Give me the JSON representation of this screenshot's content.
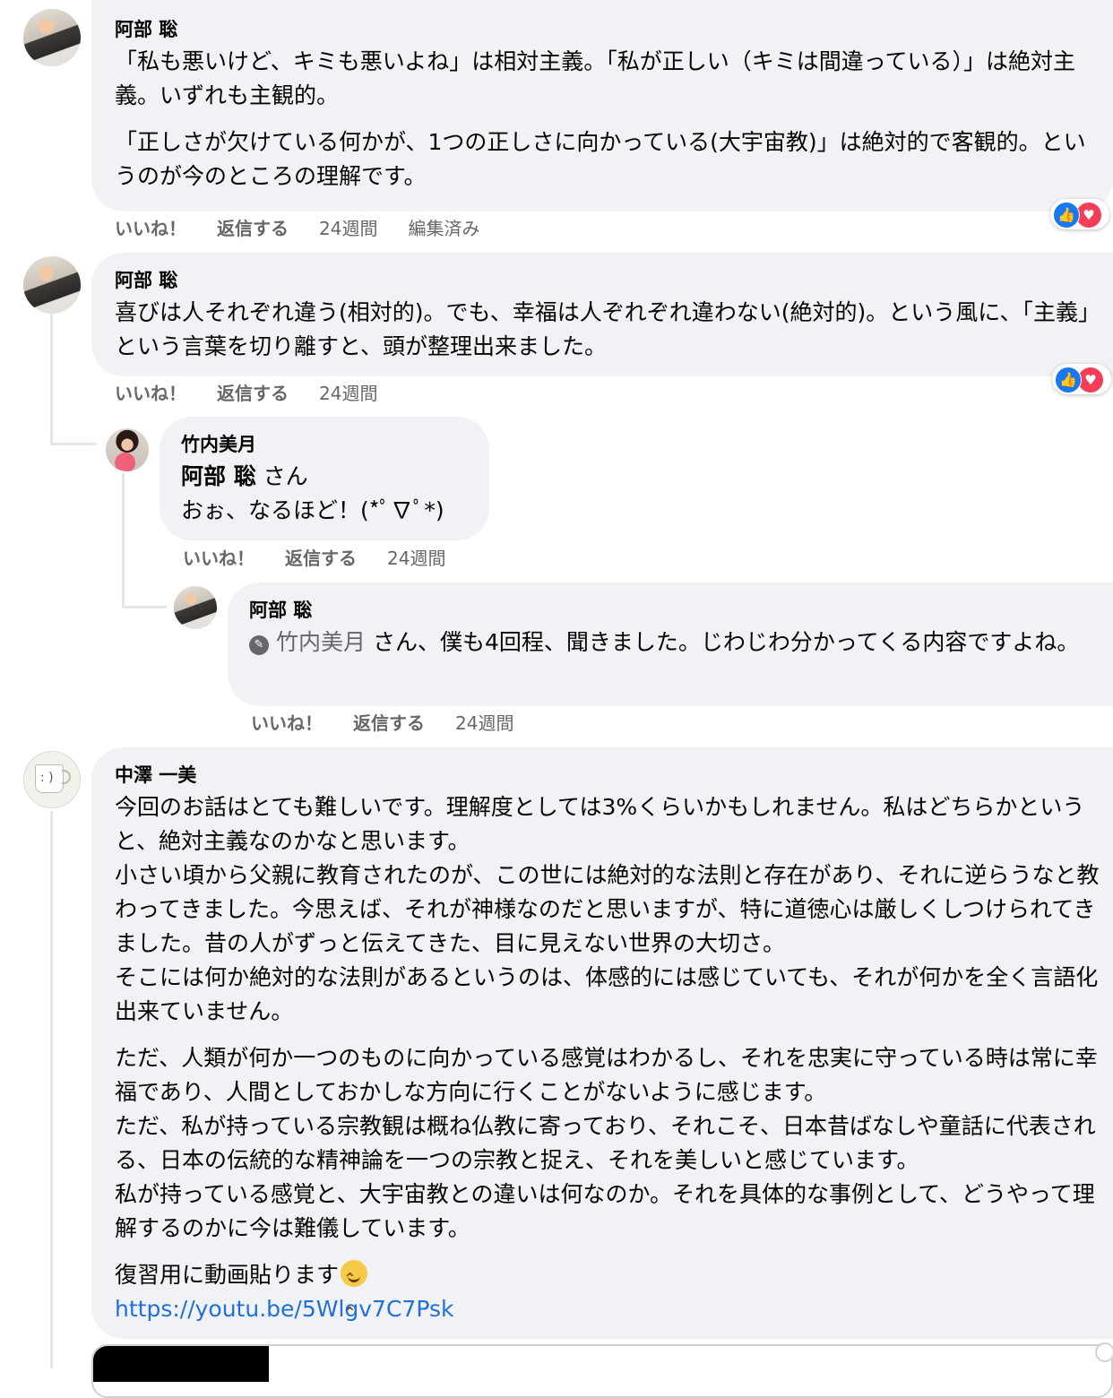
{
  "comments": [
    {
      "author": "阿部 聡",
      "paragraphs": [
        "「私も悪いけど、キミも悪いよね」は相対主義。「私が正しい（キミは間違っている）」は絶対主義。いずれも主観的。",
        "「正しさが欠けている何かが、1つの正しさに向かっている(大宇宙教)」は絶対的で客観的。というのが今のところの理解です。"
      ],
      "actions": {
        "like": "いいね！",
        "reply": "返信する",
        "time": "24週間",
        "edited": "編集済み"
      }
    },
    {
      "author": "阿部 聡",
      "text": "喜びは人それぞれ違う(相対的)。でも、幸福は人ぞれぞれ違わない(絶対的)。という風に、「主義」という言葉を切り離すと、頭が整理出来ました。",
      "actions": {
        "like": "いいね！",
        "reply": "返信する",
        "time": "24週間"
      },
      "replies": [
        {
          "author": "竹内美月",
          "mention": "阿部 聡",
          "mention_suffix": " さん",
          "text": "おぉ、なるほど！(*ﾟ∇ﾟ*)",
          "actions": {
            "like": "いいね！",
            "reply": "返信する",
            "time": "24週間"
          }
        },
        {
          "author": "阿部 聡",
          "mention": "竹内美月",
          "mention_suffix": " さん、",
          "text": "僕も4回程、聞きました。じわじわ分かってくる内容ですよね。",
          "actions": {
            "like": "いいね！",
            "reply": "返信する",
            "time": "24週間"
          }
        }
      ]
    },
    {
      "author": "中澤 一美",
      "paragraph1": "今回のお話はとても難しいです。理解度としては3%くらいかもしれません。私はどちらかというと、絶対主義なのかなと思います。\n小さい頃から父親に教育されたのが、この世には絶対的な法則と存在があり、それに逆らうなと教わってきました。今思えば、それが神様なのだと思いますが、特に道徳心は厳しくしつけられてきました。昔の人がずっと伝えてきた、目に見えない世界の大切さ。\nそこには何か絶対的な法則があるというのは、体感的には感じていても、それが何かを全く言語化出来ていません。",
      "paragraph2": "ただ、人類が何か一つのものに向かっている感覚はわかるし、それを忠実に守っている時は常に幸福であり、人間としておかしな方向に行くことがないように感じます。\nただ、私が持っている宗教観は概ね仏教に寄っており、それこそ、日本昔ばなしや童話に代表される、日本の伝統的な精神論を一つの宗教と捉え、それを美しいと感じています。\n私が持っている感覚と、大宇宙教との違いは何なのか。それを具体的な事例として、どうやって理解するのかに今は難儀しています。",
      "paragraph3": "復習用に動画貼ります",
      "link": "https://youtu.be/5Wlgv7C7Psk"
    }
  ],
  "icons": {
    "like": "like-icon",
    "love": "love-icon",
    "pencil": "pencil-icon",
    "emoji": "smiling-emoji-icon"
  },
  "colors": {
    "bubble": "#f0f2f5",
    "link": "#216fdb",
    "like": "#1877f2",
    "love": "#f33e58",
    "muted": "#65676b"
  }
}
